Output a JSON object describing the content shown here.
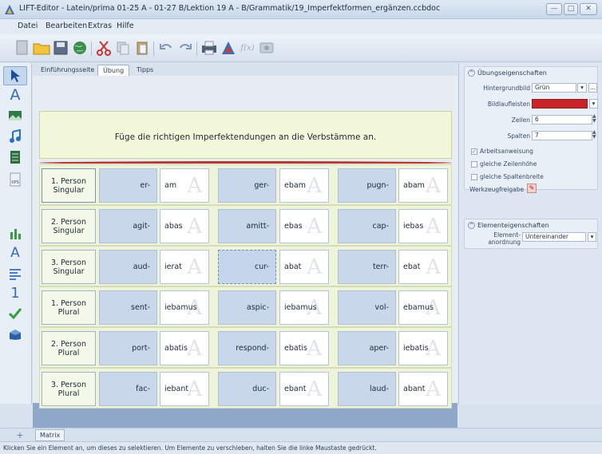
{
  "window": {
    "title": "LIFT-Editor - Latein/prima 01-25 A - 01-27 B/Lektion 19 A - B/Grammatik/19_Imperfektformen_ergänzen.ccbdoc",
    "minimize": "—",
    "maximize": "□",
    "close": "✕"
  },
  "menu": [
    "Datei",
    "Bearbeiten",
    "Extras",
    "Hilfe"
  ],
  "tabs": [
    "Einführungsseite",
    "Übung",
    "Tipps"
  ],
  "exercise": {
    "instruction": "Füge die richtigen Imperfektendungen an die Verbstämme an.",
    "rows": [
      {
        "label": "1. Person Singular",
        "cells": [
          {
            "stem": "er-",
            "ending": "am"
          },
          {
            "stem": "ger-",
            "ending": "ebam"
          },
          {
            "stem": "pugn-",
            "ending": "abam"
          }
        ]
      },
      {
        "label": "2. Person Singular",
        "cells": [
          {
            "stem": "agit-",
            "ending": "abas"
          },
          {
            "stem": "amitt-",
            "ending": "ebas"
          },
          {
            "stem": "cap-",
            "ending": "iebas"
          }
        ]
      },
      {
        "label": "3. Person Singular",
        "cells": [
          {
            "stem": "aud-",
            "ending": "ierat"
          },
          {
            "stem": "cur-",
            "ending": "abat"
          },
          {
            "stem": "terr-",
            "ending": "ebat"
          }
        ]
      },
      {
        "label": "1. Person Plural",
        "cells": [
          {
            "stem": "sent-",
            "ending": "iebamus"
          },
          {
            "stem": "aspic-",
            "ending": "iebamus"
          },
          {
            "stem": "vol-",
            "ending": "ebamus"
          }
        ]
      },
      {
        "label": "2. Person Plural",
        "cells": [
          {
            "stem": "port-",
            "ending": "abatis"
          },
          {
            "stem": "respond-",
            "ending": "ebatis"
          },
          {
            "stem": "aper-",
            "ending": "iebatis"
          }
        ]
      },
      {
        "label": "3. Person Plural",
        "cells": [
          {
            "stem": "fac-",
            "ending": "iebant"
          },
          {
            "stem": "duc-",
            "ending": "ebant"
          },
          {
            "stem": "laud-",
            "ending": "abant"
          }
        ]
      }
    ]
  },
  "properties": {
    "exercise_header": "Übungseigenschaften",
    "background_label": "Hintergrundbild",
    "background_value": "Grün",
    "scrollbar_label": "Bildlaufleisten",
    "scrollbar_color": "#c8252a",
    "rows_label": "Zeilen",
    "rows_value": "6",
    "cols_label": "Spalten",
    "cols_value": "7",
    "instruction_check": "Arbeitsanweisung",
    "equal_height": "gleiche Zeilenhöhe",
    "equal_width": "gleiche Spaltenbreite",
    "tool_release": "Werkzeugfreigabe",
    "element_header": "Elementeigenschaften",
    "arrangement_label_1": "Element-",
    "arrangement_label_2": "anordnung",
    "arrangement_value": "Untereinander",
    "ellipsis": "..."
  },
  "bottom_tab": "Matrix",
  "status": "Klicken Sie ein Element an, um dieses zu selektieren. Um Elemente zu verschieben, halten Sie die linke Maustaste gedrückt.",
  "icon_glyph": "A",
  "fx_label": "f(x)",
  "xps_label": "XPS",
  "num_glyph": "1"
}
